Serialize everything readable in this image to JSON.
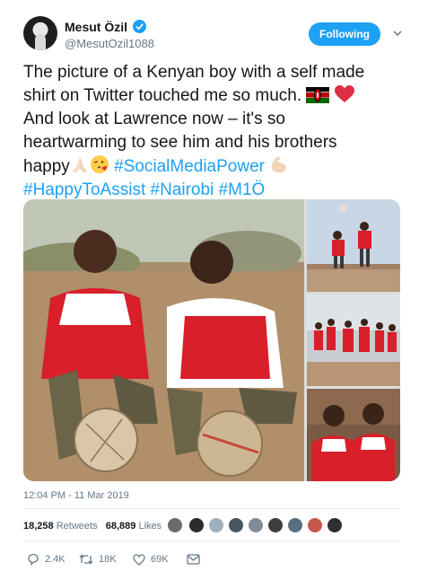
{
  "profile": {
    "name": "Mesut Özil",
    "handle": "@MesutOzil1088",
    "follow_button": "Following",
    "avatar_icon": "profile-avatar",
    "verified_icon": "verified-badge-icon"
  },
  "tweet": {
    "line1": "The picture of a Kenyan boy with a self made",
    "line2": "shirt on Twitter touched me so much.",
    "line3": "And look at Lawrence now – it's so",
    "line4": "heartwarming to see him and his brothers",
    "line5_text": "happy",
    "hashtag_social": "#SocialMediaPower",
    "hashtag_assist": "#HappyToAssist",
    "hashtag_nairobi": "#Nairobi",
    "hashtag_m10": "#M1Ö",
    "emojis": [
      "kenya-flag",
      "red-heart",
      "folded-hands",
      "face-blowing-kiss",
      "flexed-biceps"
    ]
  },
  "media": {
    "photos": [
      "Two boys in Arsenal shirts crouching with footballs",
      "Two boys playing football, kicking ball in the air",
      "Group of children in Arsenal shirts",
      "Two boys in Arsenal shirts smiling"
    ]
  },
  "meta": {
    "timestamp": "12:04 PM - 11 Mar 2019",
    "retweets_count": "18,258",
    "retweets_label": "Retweets",
    "likes_count": "68,889",
    "likes_label": "Likes"
  },
  "actions": {
    "reply_count": "2.4K",
    "retweet_count": "18K",
    "like_count": "69K"
  },
  "colors": {
    "brand_blue": "#1da1f2",
    "text_primary": "#14171a",
    "text_secondary": "#657786",
    "divider": "#e6ecf0"
  }
}
